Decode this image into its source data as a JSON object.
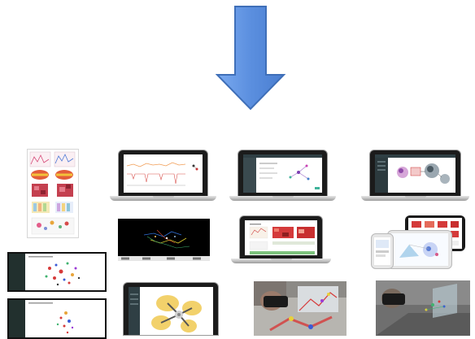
{
  "arrow": {
    "icon": "arrow-down-icon",
    "fill": "#5b8fdf",
    "stroke": "#3f6fb8"
  },
  "thumbnails": [
    {
      "name": "paper-figure-panel",
      "kind": "document"
    },
    {
      "name": "laptop-line-chart",
      "kind": "laptop"
    },
    {
      "name": "laptop-graph-dashboard",
      "kind": "laptop"
    },
    {
      "name": "laptop-cluster-dashboard",
      "kind": "laptop"
    },
    {
      "name": "dark-network-view",
      "kind": "screen"
    },
    {
      "name": "laptop-heatmap-report",
      "kind": "laptop"
    },
    {
      "name": "tablet-devices",
      "kind": "tablet"
    },
    {
      "name": "monitor-scatter-1",
      "kind": "monitor"
    },
    {
      "name": "monitor-scatter-2",
      "kind": "monitor"
    },
    {
      "name": "laptop-3d-molecule",
      "kind": "laptop"
    },
    {
      "name": "vr-headset-photo",
      "kind": "photo"
    },
    {
      "name": "vr-scene-photo",
      "kind": "photo"
    }
  ]
}
